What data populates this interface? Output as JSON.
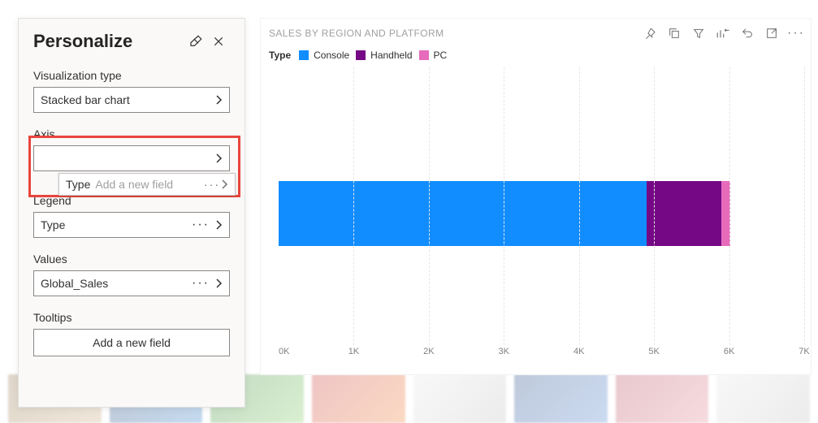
{
  "panel": {
    "title": "Personalize",
    "sections": {
      "viz_type": {
        "label": "Visualization type",
        "value": "Stacked bar chart"
      },
      "axis": {
        "label": "Axis",
        "placeholder": "Add a new field"
      },
      "legend": {
        "label": "Legend",
        "value": "Type"
      },
      "values": {
        "label": "Values",
        "value": "Global_Sales"
      },
      "tooltips": {
        "label": "Tooltips",
        "add_label": "Add a new field"
      }
    },
    "drag_chip": {
      "value": "Type",
      "placeholder": "Add a new field"
    }
  },
  "chart": {
    "title": "SALES BY REGION AND PLATFORM",
    "legend_title": "Type",
    "legend": [
      {
        "name": "Console",
        "color": "#118dff"
      },
      {
        "name": "Handheld",
        "color": "#750985"
      },
      {
        "name": "PC",
        "color": "#e66cbb"
      }
    ],
    "x_ticks": [
      "0K",
      "1K",
      "2K",
      "3K",
      "4K",
      "5K",
      "6K",
      "7K"
    ]
  },
  "chart_data": {
    "type": "bar",
    "title": "SALES BY REGION AND PLATFORM",
    "orientation": "horizontal",
    "xlabel": "",
    "ylabel": "",
    "xlim": [
      0,
      7000
    ],
    "categories": [
      ""
    ],
    "series": [
      {
        "name": "Console",
        "values": [
          4900
        ],
        "color": "#118dff"
      },
      {
        "name": "Handheld",
        "values": [
          1000
        ],
        "color": "#750985"
      },
      {
        "name": "PC",
        "values": [
          120
        ],
        "color": "#e66cbb"
      }
    ],
    "x_ticks": [
      0,
      1000,
      2000,
      3000,
      4000,
      5000,
      6000,
      7000
    ],
    "x_tick_labels": [
      "0K",
      "1K",
      "2K",
      "3K",
      "4K",
      "5K",
      "6K",
      "7K"
    ]
  }
}
